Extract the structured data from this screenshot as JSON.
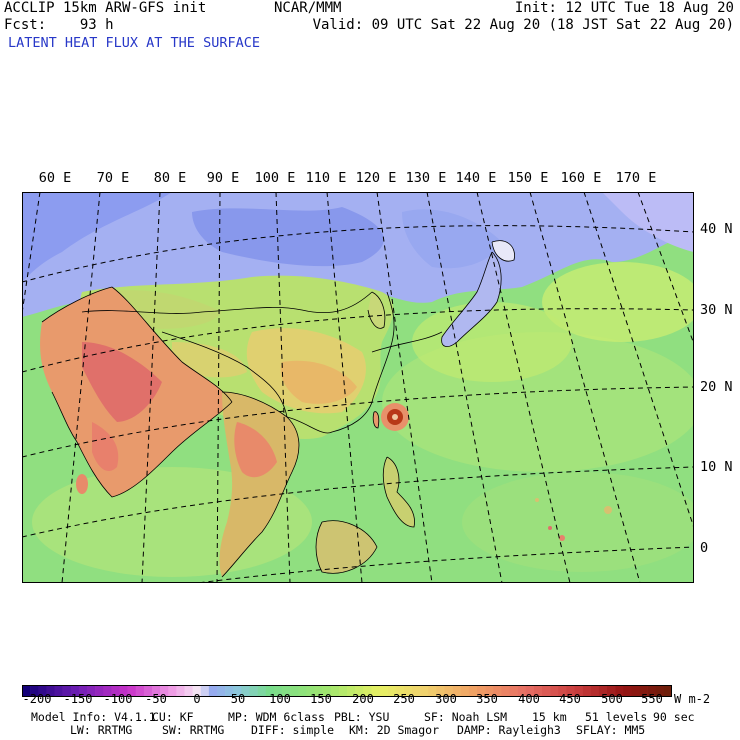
{
  "header": {
    "model": "ACCLIP 15km ARW-GFS init",
    "forecast_label": "Fcst:",
    "forecast_value": "93 h",
    "center": "NCAR/MMM",
    "init": "Init: 12 UTC Tue 18 Aug 20",
    "valid": "Valid: 09 UTC Sat 22 Aug 20 (18 JST Sat 22 Aug 20)",
    "field": "LATENT HEAT FLUX AT THE SURFACE"
  },
  "map": {
    "lon_labels": [
      "60 E",
      "70 E",
      "80 E",
      "90 E",
      "100 E",
      "110 E",
      "120 E",
      "130 E",
      "140 E",
      "150 E",
      "160 E",
      "170 E"
    ],
    "lat_labels": [
      "40 N",
      "30 N",
      "20 N",
      "10 N",
      "0"
    ],
    "colors": {
      "ocean_green": "#8ce07c",
      "ocean_yellow": "#c8ec6e",
      "land_warm": "#e8c76a",
      "land_hot": "#e88a6a",
      "cold_blue": "#8ea0f0",
      "neg_lavender": "#b4b4f4",
      "cyclone_core": "#a02810"
    },
    "features": [
      "tropical-cyclone-near-taiwan"
    ]
  },
  "colorbar": {
    "labels": [
      "-200",
      "-150",
      "-100",
      "-50",
      "0",
      "50",
      "100",
      "150",
      "200",
      "250",
      "300",
      "350",
      "400",
      "450",
      "500",
      "550"
    ],
    "unit": "W m-2"
  },
  "model_info": {
    "line1": [
      "Model Info: V4.1.1",
      "CU: KF",
      "MP: WDM 6class",
      "PBL: YSU",
      "SF: Noah LSM",
      "15 km",
      "51 levels",
      "90 sec"
    ],
    "line2": [
      "LW: RRTMG",
      "SW: RRTMG",
      "DIFF: simple",
      "KM: 2D Smagor",
      "DAMP: Rayleigh3",
      "SFLAY: MM5"
    ]
  }
}
